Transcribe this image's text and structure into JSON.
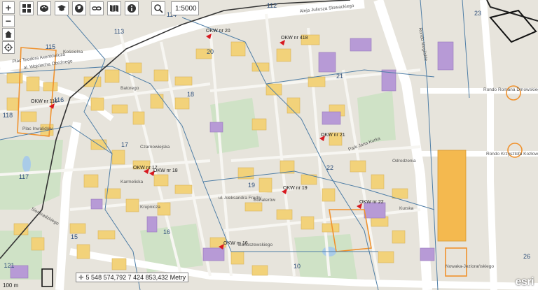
{
  "toolbar": {
    "buttons": [
      {
        "name": "zoom-in-button",
        "glyph": "+"
      },
      {
        "name": "layers-grid-button",
        "glyph": "grid"
      },
      {
        "name": "palette-button",
        "glyph": "palette"
      },
      {
        "name": "education-button",
        "glyph": "cap"
      },
      {
        "name": "globe-button",
        "glyph": "globe"
      },
      {
        "name": "link-button",
        "glyph": "link"
      },
      {
        "name": "book-button",
        "glyph": "book"
      },
      {
        "name": "info-button",
        "glyph": "info"
      },
      {
        "name": "search-button",
        "glyph": "search"
      }
    ],
    "scale_value": "1:5000"
  },
  "side": {
    "home_glyph": "home",
    "locate_glyph": "locate",
    "zoom_out": "−",
    "zoom_in": "+"
  },
  "map": {
    "district_numbers": [
      "112",
      "114",
      "113",
      "115",
      "20",
      "21",
      "23",
      "18",
      "116",
      "118",
      "17",
      "22",
      "19",
      "117",
      "16",
      "15",
      "121",
      "10",
      "26"
    ],
    "polling_stations": [
      "OKW nr 20",
      "OKW nr 418",
      "OKW nr 116",
      "OKW nr 21",
      "OKW nr 17",
      "OKW nr 18",
      "OKW nr 19",
      "OKW nr 22",
      "OKW nr 16"
    ],
    "street_labels": [
      "Aleja Juliusza Słowackiego",
      "Plac Teodora Axentowicza",
      "al. Wojciecha Oboźnego",
      "Kościelna",
      "Plac Inwalidów",
      "Rondo Mogilskie",
      "Park Jana Kurka",
      "Odrodzenia",
      "Rondo Romana Dmowskiego",
      "Rondo Krzysztofa Kozłowskiego",
      "ul. Aleksandra Fredry",
      "Bohaterów",
      "Czarnowiejska",
      "Krupnicza",
      "Karmelicka",
      "Bartoszewskiego",
      "Nowaka-Jeziorańskiego",
      "Kurska",
      "Siemiradzkiego",
      "Batorego"
    ]
  },
  "coordinates": {
    "text": "5 548 574,792 7 424 853,432 Metry"
  },
  "scalebar": {
    "label": "100 m"
  },
  "logo": "esri"
}
